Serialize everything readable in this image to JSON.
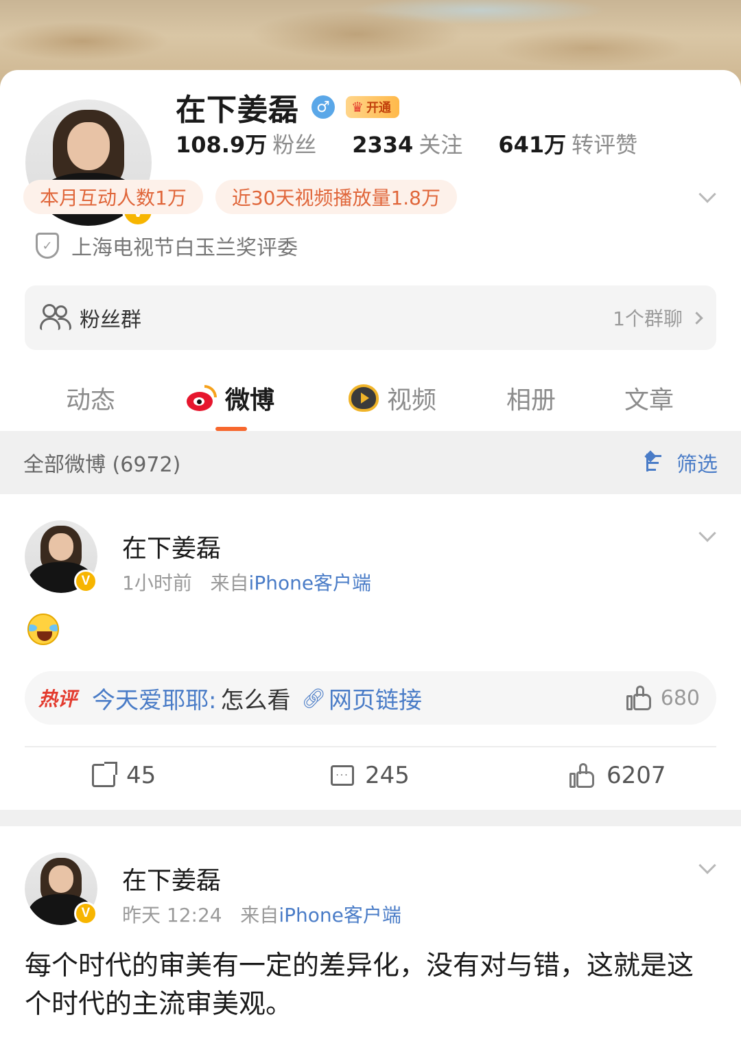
{
  "profile": {
    "name": "在下姜磊",
    "gender_symbol": "♂",
    "vip_label": "开通",
    "verified_badge": "V",
    "stats": [
      {
        "num": "108.9万",
        "label": "粉丝"
      },
      {
        "num": "2334",
        "label": "关注"
      },
      {
        "num": "641万",
        "label": "转评赞"
      }
    ],
    "chips": [
      "本月互动人数1万",
      "近30天视频播放量1.8万"
    ],
    "certification": "上海电视节白玉兰奖评委",
    "fan_group": {
      "label": "粉丝群",
      "count": "1个群聊"
    }
  },
  "tabs": [
    {
      "label": "动态",
      "active": false
    },
    {
      "label": "微博",
      "active": true
    },
    {
      "label": "视频",
      "active": false
    },
    {
      "label": "相册",
      "active": false
    },
    {
      "label": "文章",
      "active": false
    }
  ],
  "filter_bar": {
    "title": "全部微博 (6972)",
    "filter_label": "筛选"
  },
  "posts": [
    {
      "author": "在下姜磊",
      "time": "1小时前",
      "via": "来自",
      "source": "iPhone客户端",
      "content_emoji": "laugh-cry",
      "hot_comment": {
        "tag": "热评",
        "user": "今天爱耶耶:",
        "text": "怎么看",
        "link_label": "网页链接",
        "likes": "680"
      },
      "actions": {
        "reposts": "45",
        "comments": "245",
        "likes": "6207"
      }
    },
    {
      "author": "在下姜磊",
      "time": "昨天 12:24",
      "via": "来自",
      "source": "iPhone客户端",
      "text": "每个时代的审美有一定的差异化，没有对与错，这就是这个时代的主流审美观。"
    }
  ],
  "colors": {
    "accent_orange": "#f7672d",
    "link_blue": "#4a7cc7",
    "verified_gold": "#f7b500",
    "hot_red": "#e33b2e"
  }
}
